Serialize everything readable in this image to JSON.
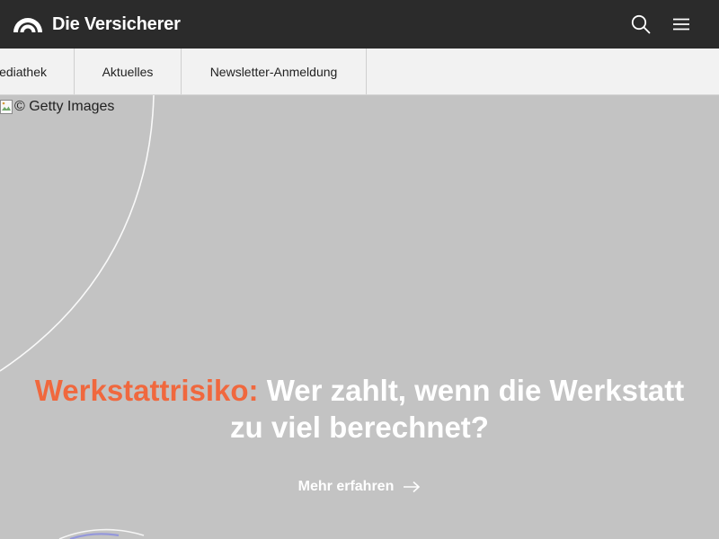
{
  "header": {
    "brand": "Die Versicherer",
    "icons": {
      "logo": "arc-logo-icon",
      "search": "search-icon",
      "menu": "hamburger-menu-icon"
    },
    "background_color": "#2b2b2b"
  },
  "subnav": {
    "items": [
      {
        "label": "ediathek"
      },
      {
        "label": "Aktuelles"
      },
      {
        "label": "Newsletter-Anmeldung"
      }
    ],
    "background_color": "#f2f2f2"
  },
  "hero": {
    "image_alt": "© Getty Images",
    "topic": "Werkstattrisiko:",
    "title_line1": "Wer zahlt, wenn die Werkstatt",
    "title_line2": "zu viel berechnet?",
    "cta_label": "Mehr erfahren",
    "cta_icon": "arrow-right-icon",
    "topic_color": "#f0683e",
    "background_color": "#c3c3c3"
  }
}
